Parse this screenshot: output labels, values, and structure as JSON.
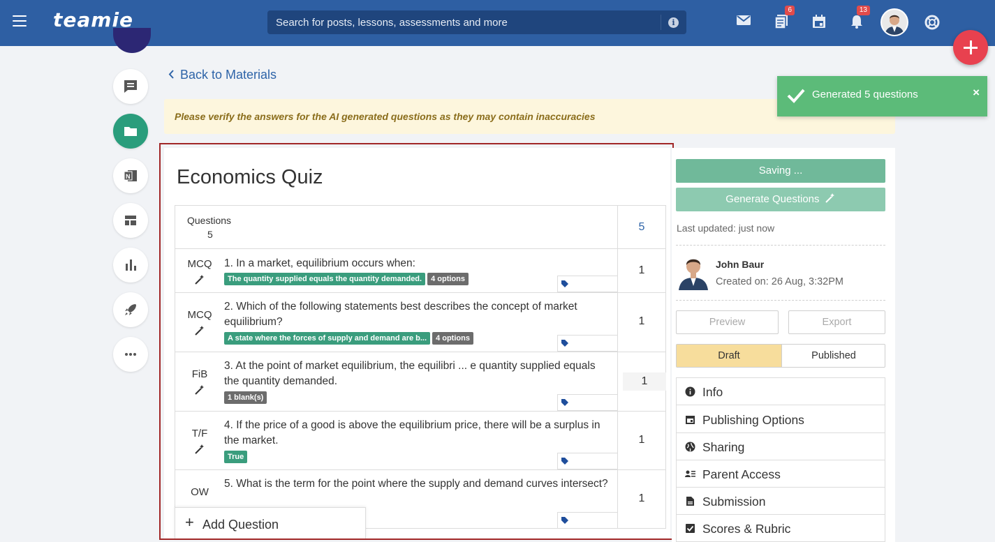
{
  "header": {
    "logo": "teamie",
    "search_placeholder": "Search for posts, lessons, assessments and more",
    "search_info": "i",
    "courses_badge": "6",
    "notifications_badge": "13"
  },
  "nav": {
    "back_label": "Back to Materials"
  },
  "warning": "Please verify the answers for the AI generated questions as they may contain inaccuracies",
  "toast": {
    "message": "Generated 5 questions",
    "close": "×"
  },
  "quiz": {
    "title": "Economics Quiz",
    "questions_label": "Questions",
    "questions_count": "5",
    "total_points": "5",
    "questions": [
      {
        "type": "MCQ",
        "text": "1. In a market, equilibrium occurs when:",
        "tags": [
          "The quantity supplied equals the quantity demanded.",
          "4 options"
        ],
        "points": "1"
      },
      {
        "type": "MCQ",
        "text": "2. Which of the following statements best describes the concept of market equilibrium?",
        "tags": [
          "A state where the forces of supply and demand are b...",
          "4 options"
        ],
        "points": "1"
      },
      {
        "type": "FiB",
        "text": "3. At the point of market equilibrium, the equilibri ... e quantity supplied equals the quantity demanded.",
        "tags": [
          "1 blank(s)"
        ],
        "points": "1"
      },
      {
        "type": "T/F",
        "text": "4. If the price of a good is above the equilibrium price, there will be a surplus in the market.",
        "tags": [
          "True"
        ],
        "points": "1"
      },
      {
        "type": "OW",
        "text": "5. What is the term for the point where the supply and demand curves intersect?",
        "tags": [],
        "points": "1"
      }
    ],
    "add_question": "Add Question"
  },
  "sidebar_right": {
    "saving_label": "Saving ...",
    "generate_label": "Generate Questions",
    "last_updated": "Last updated: just now",
    "author_name": "John Baur",
    "created_on": "Created on: 26 Aug, 3:32PM",
    "preview_label": "Preview",
    "export_label": "Export",
    "draft_label": "Draft",
    "published_label": "Published",
    "menu": [
      "Info",
      "Publishing Options",
      "Sharing",
      "Parent Access",
      "Submission",
      "Scores & Rubric"
    ]
  },
  "colors": {
    "topbar": "#2e5fa3",
    "accent_green": "#3a9d7d",
    "fab_red": "#e8414f",
    "frame_red": "#a12727",
    "toast_green": "#5cbb79"
  }
}
